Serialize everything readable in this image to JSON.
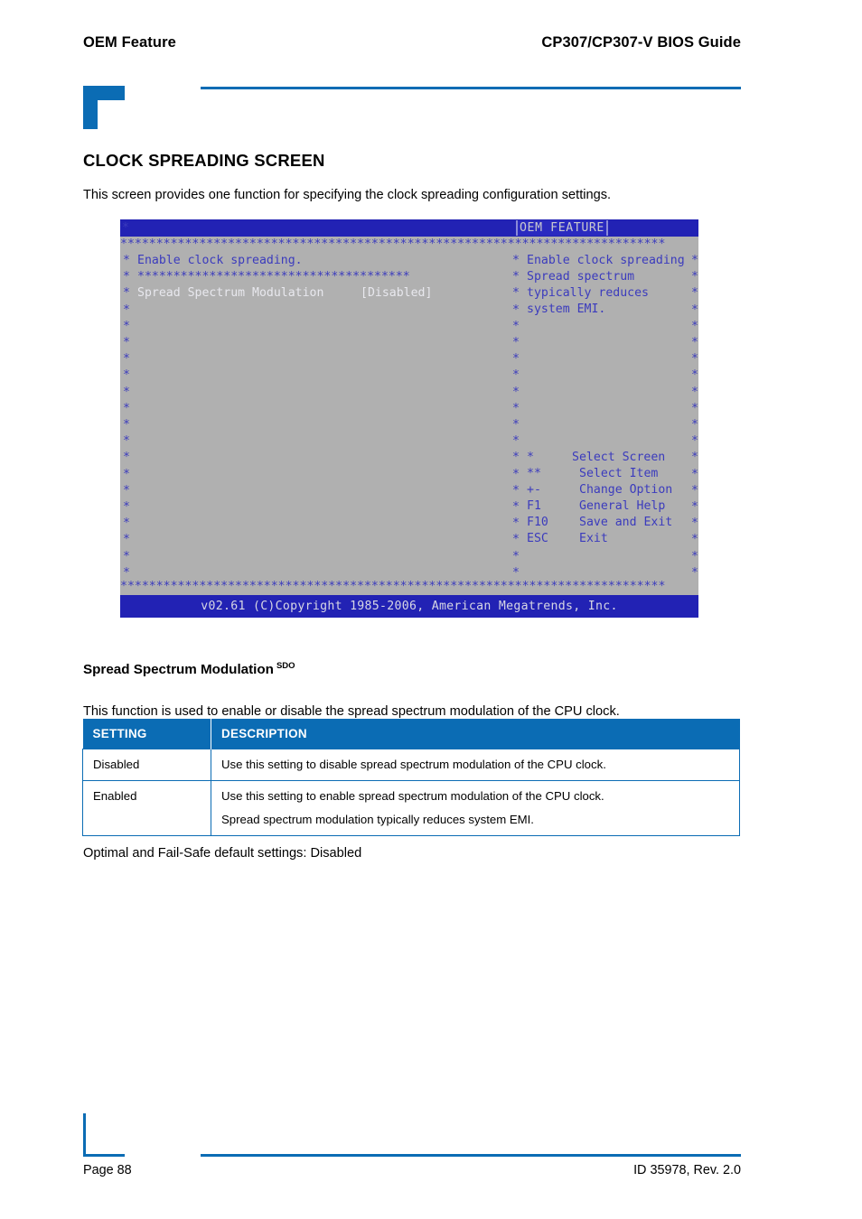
{
  "header": {
    "left_title": "OEM Feature",
    "right_title": "CP307/CP307-V BIOS Guide",
    "accent_color": "#0b6cb4"
  },
  "section": {
    "heading": "CLOCK SPREADING SCREEN",
    "intro": "This screen provides one function for specifying the clock spreading configuration settings."
  },
  "bios": {
    "title_bar_label": "OEM FEATURE",
    "top_left_star": "*",
    "rule_stars": "****************************************************************************",
    "inner_rule_stars": "**************************************",
    "star_column": "*\n*\n*\n*\n*\n*\n*\n*\n*\n*\n*\n*\n*\n*\n*\n*\n*\n*\n*\n*",
    "help_text_line": "Enable clock spreading.",
    "setting_label": "Spread Spectrum Modulation",
    "setting_value": "[Disabled]",
    "help_panel": [
      "Enable clock spreading",
      "Spread spectrum",
      "typically reduces",
      "system EMI."
    ],
    "nav_keys": [
      {
        "key": "*",
        "action": "Select Screen"
      },
      {
        "key": "**",
        "action": "Select Item"
      },
      {
        "key": "+-",
        "action": "Change Option"
      },
      {
        "key": "F1",
        "action": "General Help"
      },
      {
        "key": "F10",
        "action": "Save and Exit"
      },
      {
        "key": "ESC",
        "action": "Exit"
      }
    ],
    "footer": "v02.61 (C)Copyright 1985-2006, American Megatrends, Inc.",
    "bg_color": "#b0b0b0",
    "blue_color": "#3b3bbd",
    "bar_color": "#2222b4"
  },
  "setting_section": {
    "heading": "Spread Spectrum Modulation",
    "heading_superscript": "SDO",
    "description": "This function is used to enable or disable the spread spectrum modulation of the CPU clock.",
    "table": {
      "headers": [
        "SETTING",
        "DESCRIPTION"
      ],
      "rows": [
        {
          "setting": "Disabled",
          "lines": [
            "Use this setting to disable spread spectrum modulation of the CPU clock."
          ]
        },
        {
          "setting": "Enabled",
          "lines": [
            "Use this setting to enable spread spectrum modulation of the CPU clock.",
            "Spread spectrum modulation typically reduces system EMI."
          ]
        }
      ]
    },
    "closing_note": "Optimal and Fail-Safe default settings: Disabled"
  },
  "footer": {
    "page_label": "Page 88",
    "doc_id": "ID 35978, Rev. 2.0"
  }
}
